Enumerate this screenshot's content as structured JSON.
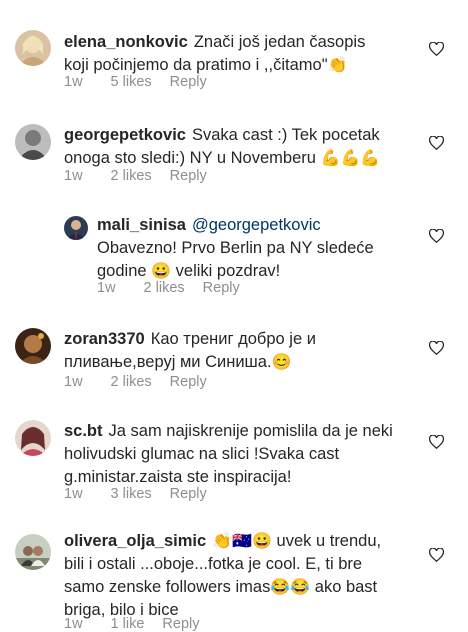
{
  "comments": [
    {
      "username": "elena_nonkovic",
      "text": "Znači još jedan časopis koji počinjemo da pratimo i ,,čitamo\"",
      "emoji": "👏",
      "time": "1w",
      "likes": "5 likes",
      "reply": "Reply",
      "avatar_color": "#e8cda0"
    },
    {
      "username": "georgepetkovic",
      "text": "Svaka cast :) Tek pocetak onoga sto sledi:) NY u Novemberu",
      "emoji": "💪💪💪",
      "time": "1w",
      "likes": "2 likes",
      "reply": "Reply",
      "avatar_color": "#8c8c8c"
    },
    {
      "username": "mali_sinisa",
      "mention": "@georgepetkovic",
      "text": "Obavezno! Prvo Berlin pa NY sledeće godine",
      "emoji": "😀",
      "text2": "veliki pozdrav!",
      "time": "1w",
      "likes": "2 likes",
      "reply": "Reply",
      "avatar_color": "#3a4a6b"
    },
    {
      "username": "zoran3370",
      "text": "Као трениг добро је и пливање,веруј ми Синиша.",
      "emoji": "😊",
      "time": "1w",
      "likes": "2 likes",
      "reply": "Reply",
      "avatar_color": "#6b4a2a"
    },
    {
      "username": "sc.bt",
      "text": "Ja sam najiskrenije pomislila da je neki holivudski glumac na slici !Svaka cast g.ministar.zaista ste inspiracija!",
      "time": "1w",
      "likes": "3 likes",
      "reply": "Reply",
      "avatar_color": "#b07a7a"
    },
    {
      "username": "olivera_olja_simic",
      "emoji_lead": "👏🇦🇺😀",
      "text": "uvek u trendu, bili i ostali ...oboje...fotka je cool. E, ti bre samo zenske followers imas",
      "emoji": "😂😂",
      "text2": "ako bast briga, bilo i bice",
      "time": "1w",
      "likes": "1 like",
      "reply": "Reply",
      "avatar_color": "#9aa590"
    }
  ],
  "icons": {
    "like": "heart-outline-icon"
  }
}
